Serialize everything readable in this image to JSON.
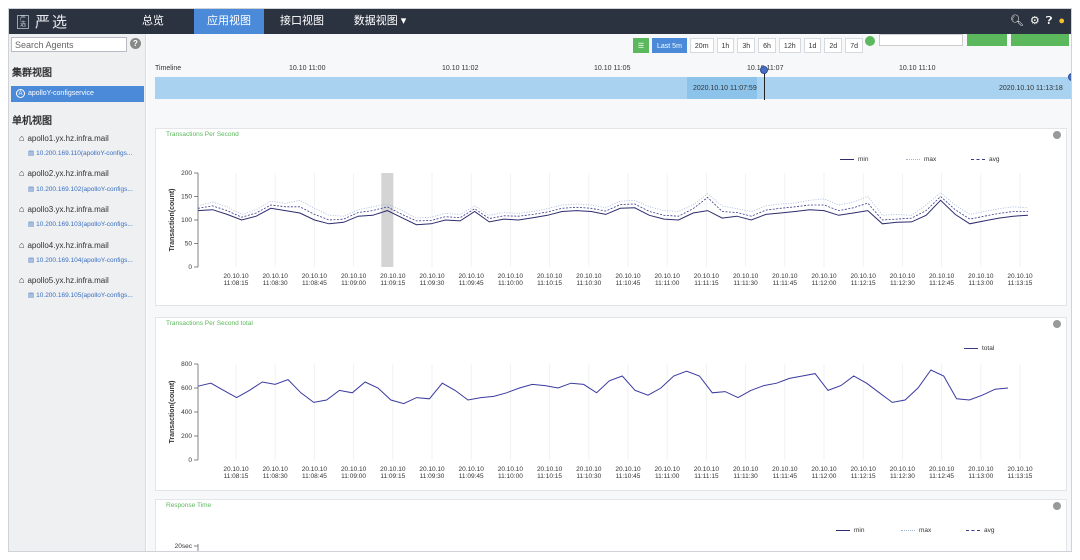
{
  "nav": {
    "logo_badge": "严选",
    "logo_text": "严选",
    "items": [
      "总览",
      "应用视图",
      "接口视图",
      "数据视图 ▾"
    ],
    "active_index": 1
  },
  "sidebar": {
    "search_placeholder": "Search Agents",
    "help": "?",
    "cluster_title": "集群视图",
    "cluster_item": "apolloY-configservice",
    "cluster_icon": "A",
    "single_title": "单机视图",
    "hosts": [
      {
        "name": "apollo1.yx.hz.infra.mail",
        "agent": "10.200.169.110(apolloY-configs..."
      },
      {
        "name": "apollo2.yx.hz.infra.mail",
        "agent": "10.200.169.102(apolloY-configs..."
      },
      {
        "name": "apollo3.yx.hz.infra.mail",
        "agent": "10.200.169.103(apolloY-configs..."
      },
      {
        "name": "apollo4.yx.hz.infra.mail",
        "agent": "10.200.169.104(apolloY-configs..."
      },
      {
        "name": "apollo5.yx.hz.infra.mail",
        "agent": "10.200.169.105(apolloY-configs..."
      }
    ]
  },
  "range": {
    "list_icon": "list-icon",
    "options": [
      "Last 5m",
      "20m",
      "1h",
      "3h",
      "6h",
      "12h",
      "1d",
      "2d",
      "7d"
    ],
    "active_index": 0
  },
  "timeline": {
    "label": "Timeline",
    "ticks": [
      "10.10 11:00",
      "10.10 11:02",
      "10.10 11:05",
      "10.10 11:07",
      "10.10 11:10"
    ],
    "cursor_time": "2020.10.10 11:07:59",
    "end_time": "2020.10.10 11:13:18"
  },
  "x_ticks": [
    "11:08:15",
    "11:08:30",
    "11:08:45",
    "11:09:00",
    "11:09:15",
    "11:09:30",
    "11:09:45",
    "11:10:00",
    "11:10:15",
    "11:10:30",
    "11:10:45",
    "11:11:00",
    "11:11:15",
    "11:11:30",
    "11:11:45",
    "11:12:00",
    "11:12:15",
    "11:12:30",
    "11:12:45",
    "11:13:00",
    "11:13:15"
  ],
  "x_date": "20.10.10",
  "colors": {
    "nav": "#2c3340",
    "accent": "#4a8ad8",
    "green": "#5cb85c",
    "series_dark": "#2c2c6e",
    "series_light": "#9fb5d8"
  },
  "chart_data": [
    {
      "type": "line",
      "title": "Transactions Per Second",
      "ylabel": "Transaction(count)",
      "ylim": [
        0,
        200
      ],
      "yticks": [
        0,
        50,
        100,
        150,
        200
      ],
      "legend_placement": "top-right",
      "series": [
        {
          "name": "min",
          "values": [
            120,
            122,
            112,
            100,
            108,
            125,
            120,
            115,
            100,
            92,
            95,
            108,
            110,
            120,
            105,
            90,
            92,
            100,
            98,
            118,
            96,
            102,
            100,
            105,
            110,
            118,
            120,
            118,
            112,
            125,
            126,
            110,
            102,
            100,
            115,
            120,
            104,
            108,
            100,
            112,
            115,
            118,
            122,
            120,
            110,
            115,
            120,
            92,
            95,
            96,
            110,
            142,
            112,
            92,
            98,
            104,
            108,
            110
          ]
        },
        {
          "name": "max",
          "values": [
            130,
            138,
            128,
            112,
            122,
            140,
            135,
            142,
            125,
            110,
            108,
            122,
            128,
            134,
            120,
            104,
            106,
            114,
            112,
            130,
            110,
            116,
            114,
            118,
            124,
            132,
            134,
            132,
            126,
            140,
            142,
            128,
            120,
            118,
            132,
            156,
            130,
            124,
            118,
            130,
            134,
            136,
            142,
            145,
            132,
            138,
            150,
            110,
            112,
            110,
            132,
            158,
            132,
            112,
            118,
            124,
            128,
            126
          ]
        },
        {
          "name": "avg",
          "values": [
            125,
            130,
            120,
            106,
            115,
            132,
            128,
            128,
            112,
            100,
            102,
            116,
            120,
            128,
            112,
            98,
            99,
            107,
            105,
            124,
            103,
            109,
            108,
            112,
            117,
            125,
            127,
            125,
            119,
            133,
            134,
            118,
            110,
            108,
            124,
            148,
            118,
            116,
            108,
            121,
            125,
            128,
            132,
            132,
            120,
            126,
            136,
            100,
            102,
            104,
            120,
            150,
            122,
            102,
            108,
            114,
            118,
            118
          ]
        }
      ],
      "highlight_index": 13
    },
    {
      "type": "line",
      "title": "Transactions Per Second total",
      "ylabel": "Transaction(count)",
      "ylim": [
        0,
        800
      ],
      "yticks": [
        0,
        200,
        400,
        600,
        800
      ],
      "legend_placement": "top-right",
      "series": [
        {
          "name": "total",
          "values": [
            615,
            640,
            580,
            520,
            580,
            650,
            630,
            670,
            560,
            480,
            500,
            580,
            560,
            650,
            600,
            500,
            470,
            520,
            510,
            640,
            580,
            500,
            520,
            530,
            560,
            600,
            630,
            620,
            600,
            640,
            630,
            560,
            660,
            700,
            580,
            540,
            600,
            700,
            740,
            700,
            560,
            570,
            520,
            580,
            620,
            640,
            680,
            700,
            720,
            580,
            620,
            700,
            640,
            560,
            480,
            500,
            600,
            750,
            700,
            510,
            500,
            540,
            590,
            600
          ]
        }
      ]
    },
    {
      "type": "line",
      "title": "Response Time",
      "ylabel": "",
      "yticks_label": [
        "20sec"
      ],
      "legend_placement": "top-right",
      "series": [
        {
          "name": "min",
          "values": []
        },
        {
          "name": "max",
          "values": []
        },
        {
          "name": "avg",
          "values": []
        }
      ]
    }
  ]
}
